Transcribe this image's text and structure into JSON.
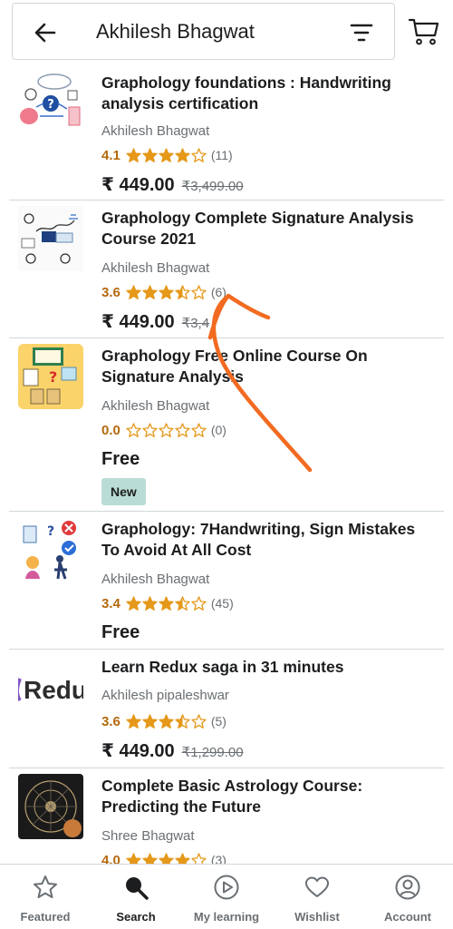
{
  "header": {
    "search_query": "Akhilesh Bhagwat"
  },
  "courses": [
    {
      "title": "Graphology foundations : Handwriting analysis certification",
      "author": "Akhilesh Bhagwat",
      "rating": "4.1",
      "stars": 4.1,
      "reviews": "(11)",
      "price": "₹ 449.00",
      "original_price": "₹3,499.00"
    },
    {
      "title": "Graphology Complete Signature Analysis Course 2021",
      "author": "Akhilesh Bhagwat",
      "rating": "3.6",
      "stars": 3.6,
      "reviews": "(6)",
      "price": "₹ 449.00",
      "original_price": "₹3,4"
    },
    {
      "title": "Graphology Free Online Course On Signature Analysis",
      "author": "Akhilesh Bhagwat",
      "rating": "0.0",
      "stars": 0,
      "reviews": "(0)",
      "price": "Free",
      "badge": "New"
    },
    {
      "title": "Graphology: 7Handwriting, Sign Mistakes To Avoid At All Cost",
      "author": "Akhilesh Bhagwat",
      "rating": "3.4",
      "stars": 3.4,
      "reviews": "(45)",
      "price": "Free"
    },
    {
      "title": "Learn Redux saga in 31 minutes",
      "author": "Akhilesh pipaleshwar",
      "rating": "3.6",
      "stars": 3.6,
      "reviews": "(5)",
      "price": "₹ 449.00",
      "original_price": "₹1,299.00",
      "thumb_text": "Redu"
    },
    {
      "title": "Complete Basic Astrology Course: Predicting the Future",
      "author": "Shree Bhagwat",
      "rating": "4.0",
      "stars": 4.0,
      "reviews": "(3)"
    }
  ],
  "nav": {
    "featured": "Featured",
    "search": "Search",
    "my_learning": "My learning",
    "wishlist": "Wishlist",
    "account": "Account"
  },
  "colors": {
    "rating": "#b4690e",
    "star": "#e59819",
    "annotation": "#f26b21",
    "badge_bg": "#b9ddd5"
  }
}
